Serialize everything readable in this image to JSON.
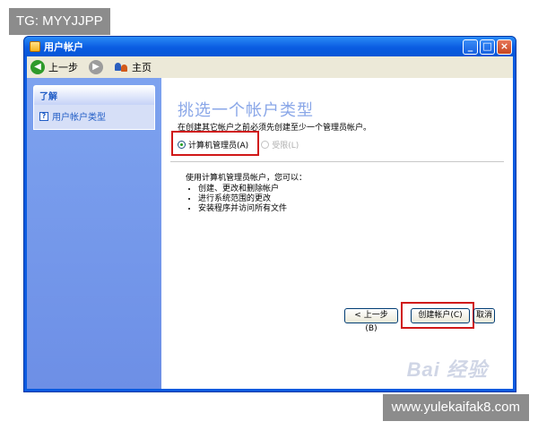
{
  "overlay": {
    "top_tag": "TG: MYYJJPP",
    "bottom_site": "www.yulekaifak8.com"
  },
  "window": {
    "title": "用户帐户",
    "buttons": {
      "minimize": "_",
      "maximize": "□",
      "close": "×"
    }
  },
  "toolbar": {
    "back_label": "上一步",
    "home_label": "主页",
    "icons": {
      "back": "green-circle-arrow",
      "forward": "gray-circle-arrow",
      "home": "users-icon"
    }
  },
  "sidebar": {
    "section_title": "了解",
    "items": [
      {
        "label": "用户帐户类型",
        "icon": "help-icon"
      }
    ]
  },
  "main": {
    "heading": "挑选一个帐户类型",
    "description": "在创建其它帐户之前必须先创建至少一个管理员帐户。",
    "options": [
      {
        "label": "计算机管理员(A)",
        "checked": true,
        "enabled": true
      },
      {
        "label": "受限(L)",
        "checked": false,
        "enabled": false
      }
    ],
    "info_title": "使用计算机管理员帐户，您可以：",
    "info_items": [
      "创建、更改和删除帐户",
      "进行系统范围的更改",
      "安装程序并访问所有文件"
    ],
    "buttons": {
      "back": "< 上一步(B)",
      "create": "创建帐户(C)",
      "cancel": "取消"
    },
    "watermark": "Bai 经验"
  },
  "colors": {
    "titlebar": "#0a5ce2",
    "sidebar": "#7da2ef",
    "heading": "#8aa7e8",
    "highlight": "#d01818"
  }
}
